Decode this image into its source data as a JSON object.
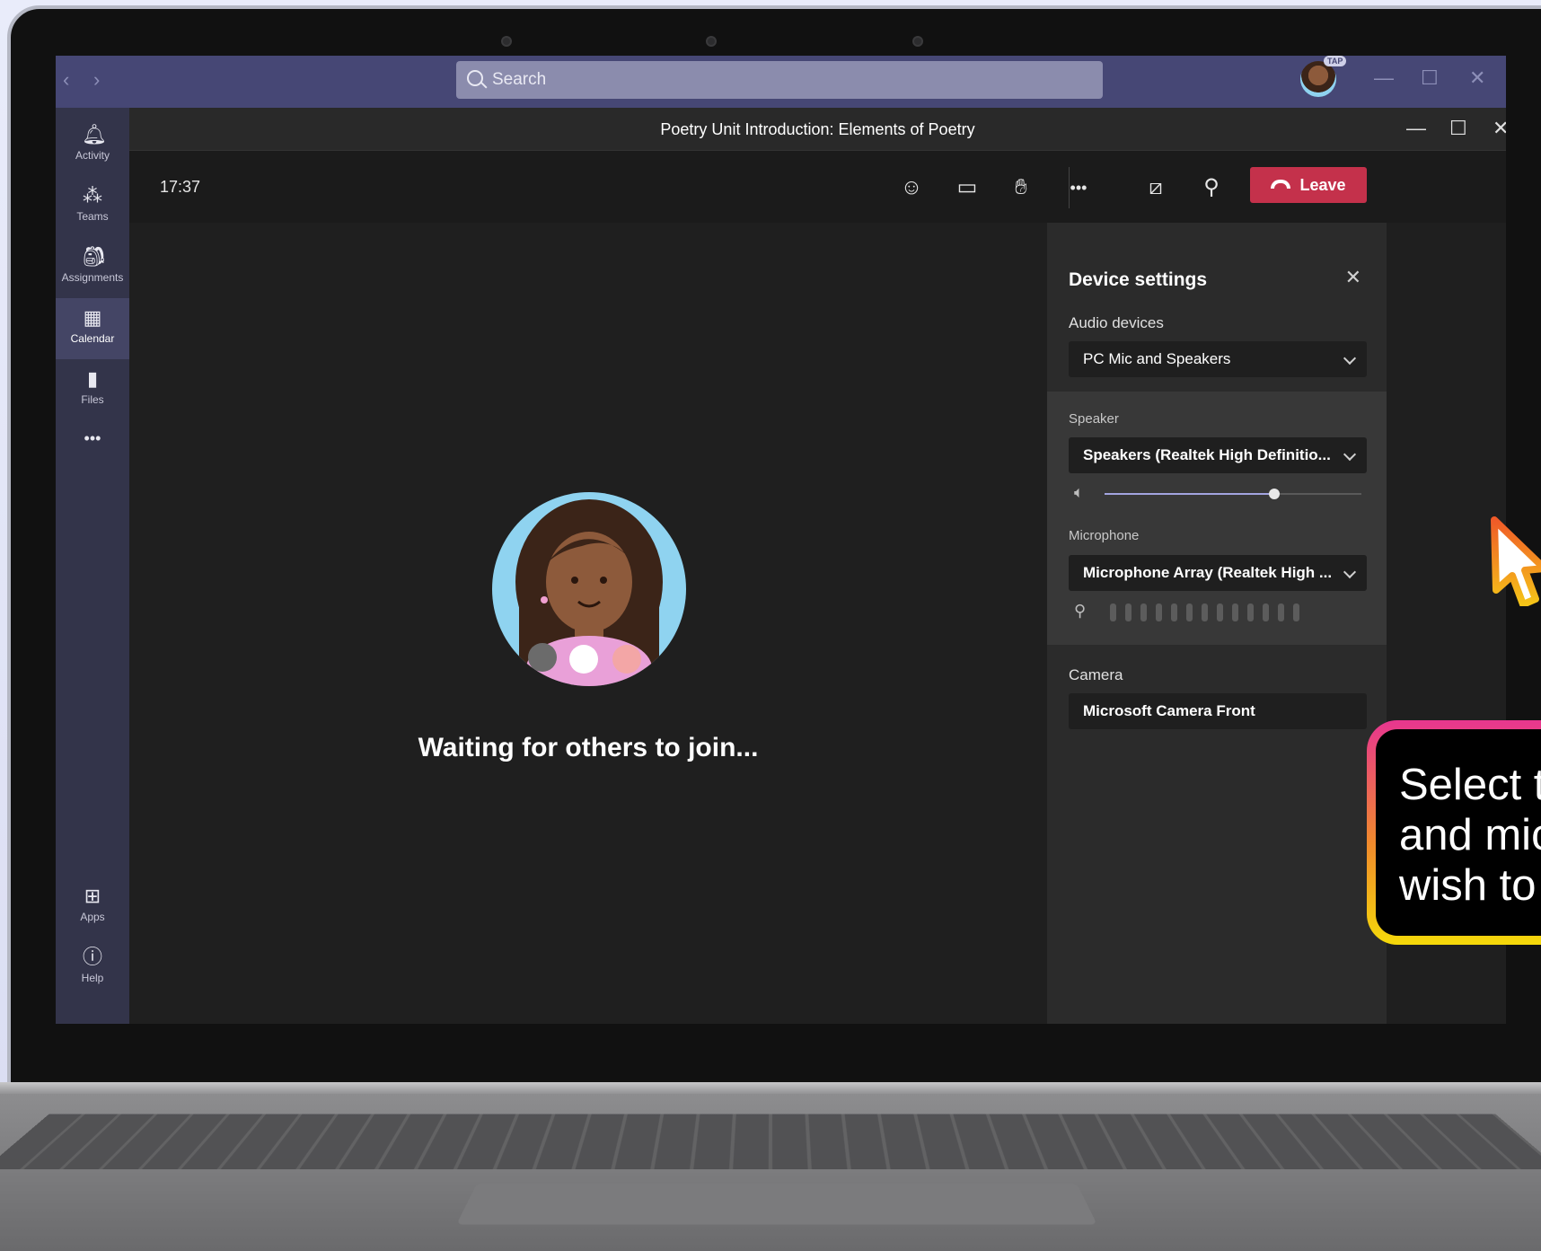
{
  "window": {
    "search_placeholder": "Search",
    "avatar_badge": "TAP"
  },
  "rail": {
    "items": [
      {
        "label": "Activity",
        "icon": "bell-icon"
      },
      {
        "label": "Teams",
        "icon": "teams-icon"
      },
      {
        "label": "Assignments",
        "icon": "assignments-icon"
      },
      {
        "label": "Calendar",
        "icon": "calendar-icon"
      },
      {
        "label": "Files",
        "icon": "file-icon"
      },
      {
        "label": "Apps",
        "icon": "apps-icon"
      },
      {
        "label": "Help",
        "icon": "help-icon"
      }
    ],
    "more_label": "•••"
  },
  "meeting": {
    "title": "Poetry Unit Introduction: Elements of Poetry",
    "clock": "17:37",
    "leave_label": "Leave",
    "waiting_text": "Waiting for others to join..."
  },
  "device_settings": {
    "title": "Device settings",
    "audio_devices_label": "Audio devices",
    "audio_devices_value": "PC Mic and Speakers",
    "speaker_label": "Speaker",
    "speaker_value": "Speakers (Realtek High Definitio...",
    "speaker_volume": 0.66,
    "microphone_label": "Microphone",
    "microphone_value": "Microphone Array (Realtek High ...",
    "camera_label": "Camera",
    "camera_value": "Microsoft Camera Front"
  },
  "callout": {
    "text": "Select t\nand mic\nwish to"
  },
  "colors": {
    "teams_purple": "#464775",
    "leave_red": "#c4314b",
    "slider_accent": "#a2a4e0"
  }
}
